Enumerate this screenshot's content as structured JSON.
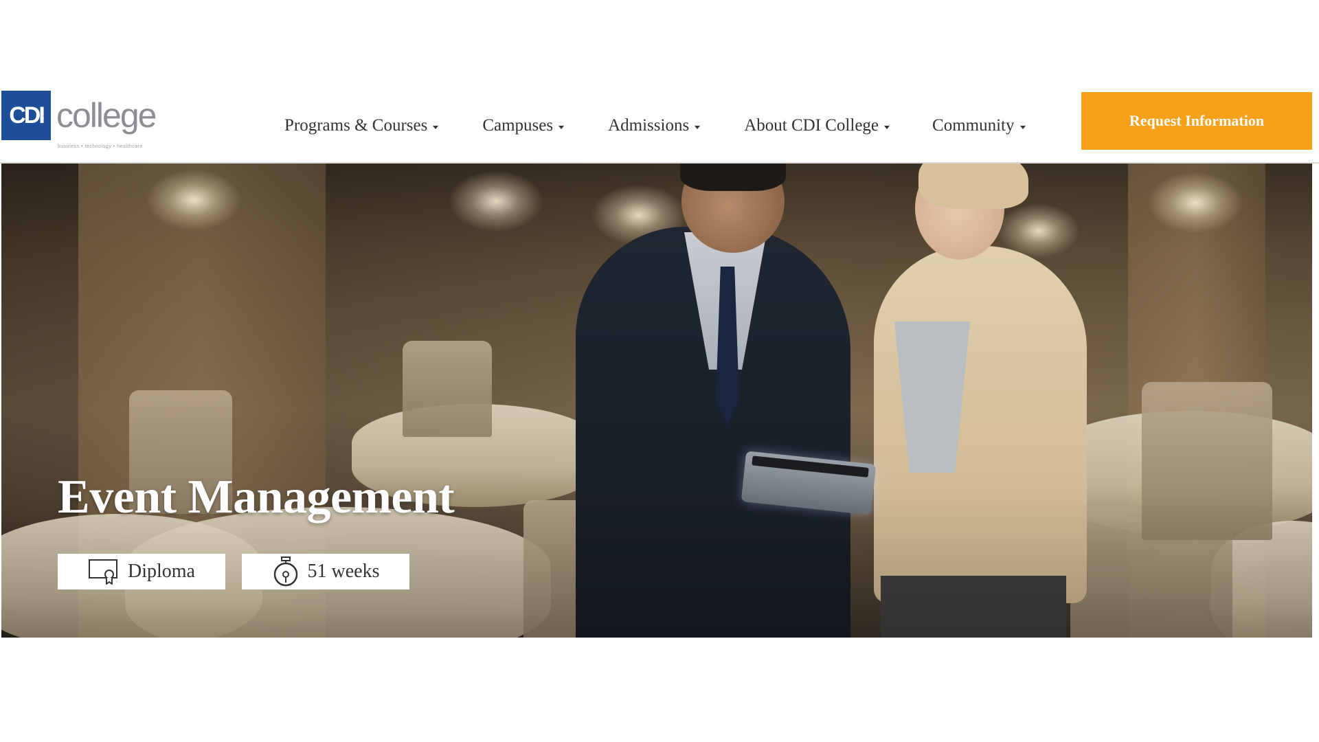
{
  "header": {
    "logo": {
      "mark": "CDI",
      "wordmark": "college",
      "tagline": "business • technology • healthcare"
    },
    "nav": [
      {
        "label": "Programs & Courses",
        "has_dropdown": true
      },
      {
        "label": "Campuses",
        "has_dropdown": true
      },
      {
        "label": "Admissions",
        "has_dropdown": true
      },
      {
        "label": "About CDI College",
        "has_dropdown": true
      },
      {
        "label": "Community",
        "has_dropdown": true
      }
    ],
    "cta_label": "Request Information"
  },
  "hero": {
    "title": "Event Management",
    "badges": {
      "credential": {
        "label": "Diploma",
        "icon": "certificate-icon"
      },
      "duration": {
        "label": "51 weeks",
        "icon": "stopwatch-icon"
      }
    }
  },
  "colors": {
    "brand_blue": "#1f4e99",
    "logo_gray": "#8b8f94",
    "accent_orange": "#f7a11a",
    "nav_text": "#333333",
    "hero_title": "#ffffff"
  }
}
